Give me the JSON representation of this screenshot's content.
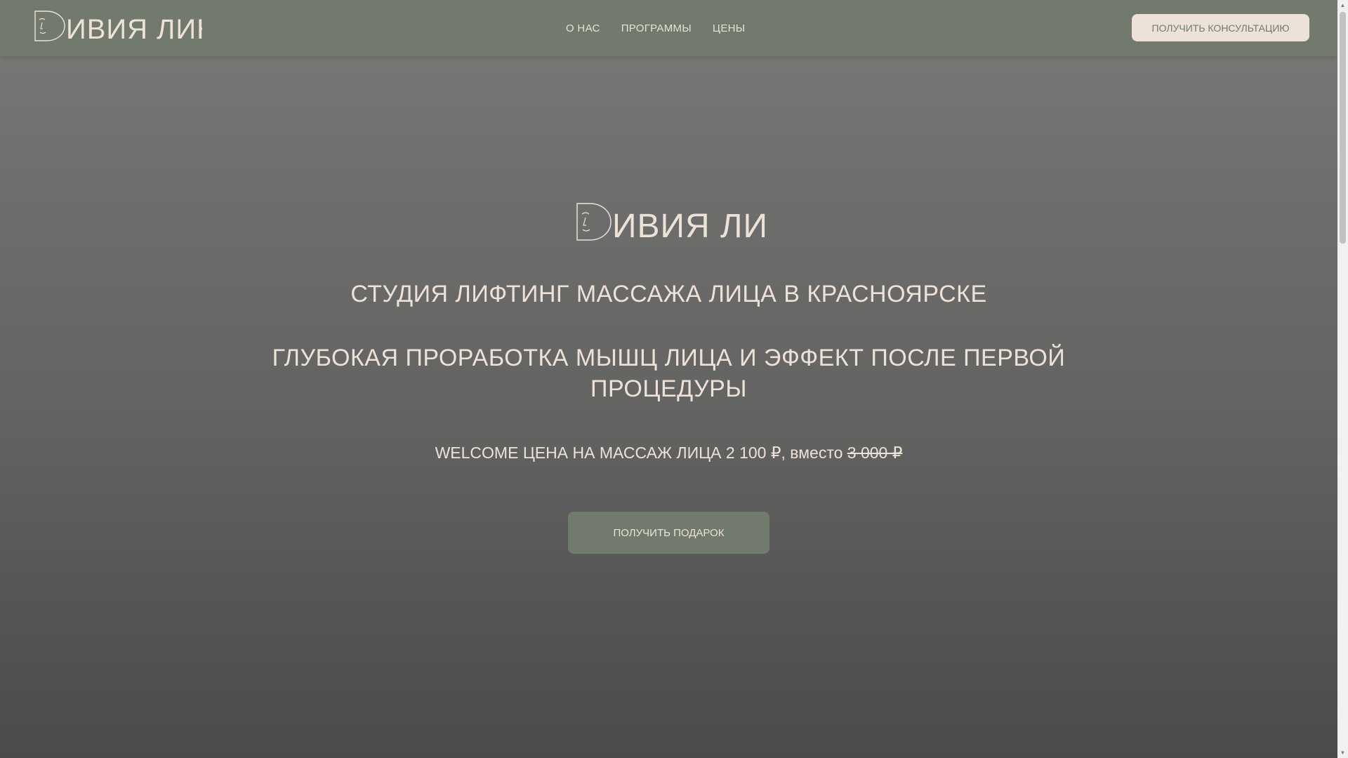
{
  "brand": {
    "logo_text": "ДИВИЯ ЛИК",
    "accent_color": "#727a6d",
    "cream_color": "#ece2d8"
  },
  "header": {
    "nav": [
      {
        "label": "О НАС"
      },
      {
        "label": "ПРОГРАММЫ"
      },
      {
        "label": "ЦЕНЫ"
      }
    ],
    "cta_label": "ПОЛУЧИТЬ КОНСУЛЬТАЦИЮ"
  },
  "hero": {
    "title": "СТУДИЯ ЛИФТИНГ МАССАЖА ЛИЦА В КРАСНОЯРСКЕ",
    "subtitle": "ГЛУБОКАЯ ПРОРАБОТКА МЫШЦ ЛИЦА И ЭФФЕКТ ПОСЛЕ ПЕРВОЙ ПРОЦЕДУРЫ",
    "offer_prefix": "WELCOME ЦЕНА НА МАССАЖ ЛИЦА 2 100 ₽, вместо ",
    "offer_old_price": "3 000 ₽",
    "cta_label": "ПОЛУЧИТЬ ПОДАРОК"
  },
  "scrollbar": {
    "up_icon": "scroll-up-arrow-icon",
    "down_icon": "scroll-down-arrow-icon"
  }
}
